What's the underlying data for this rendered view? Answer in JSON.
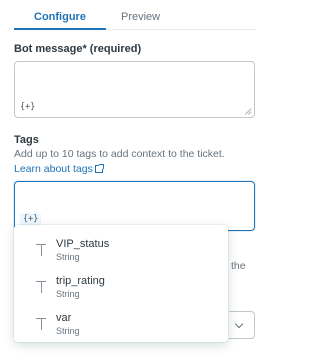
{
  "tabs": [
    {
      "label": "Configure",
      "active": true
    },
    {
      "label": "Preview",
      "active": false
    }
  ],
  "bot_message": {
    "label": "Bot message* (required)",
    "value": "",
    "variable_button": "{+}"
  },
  "tags": {
    "label": "Tags",
    "hint_prefix": "Add up to 10 tags to add context to the ticket. ",
    "hint_link": "Learn about tags",
    "value": "",
    "variable_button": "{+}"
  },
  "background_peek": {
    "text": "the"
  },
  "variable_dropdown": {
    "options": [
      {
        "name": "VIP_status",
        "type": "String",
        "icon": "text-type-icon"
      },
      {
        "name": "trip_rating",
        "type": "String",
        "icon": "text-type-icon"
      },
      {
        "name": "var",
        "type": "String",
        "icon": "text-type-icon"
      }
    ]
  },
  "colors": {
    "accent": "#1f73b7",
    "text": "#2f3941",
    "muted": "#68737d",
    "border": "#c2c8cc"
  }
}
